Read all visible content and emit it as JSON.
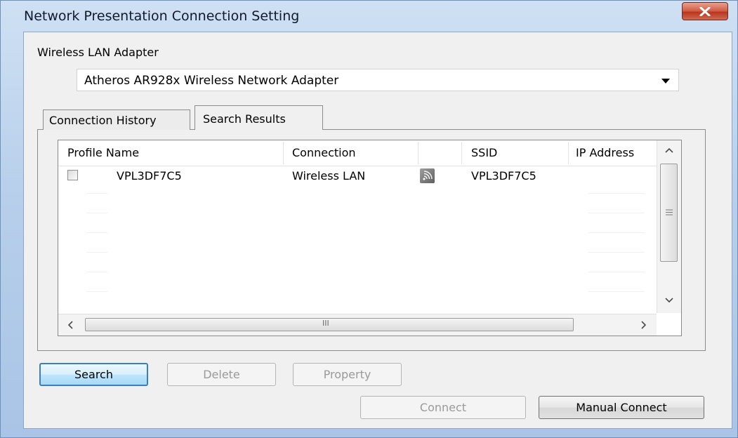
{
  "window": {
    "title": "Network Presentation Connection Setting"
  },
  "adapter": {
    "label": "Wireless LAN Adapter",
    "selected": "Atheros AR928x Wireless Network Adapter"
  },
  "tabs": [
    {
      "label": "Connection History",
      "active": false
    },
    {
      "label": "Search Results",
      "active": true
    }
  ],
  "table": {
    "columns": [
      "Profile Name",
      "Connection",
      "",
      "SSID",
      "IP Address"
    ],
    "rows": [
      {
        "profile": "VPL3DF7C5",
        "connection": "Wireless LAN",
        "icon": "wireless-signal-icon",
        "ssid": "VPL3DF7C5",
        "ip": ""
      }
    ],
    "hscroll_grip": "III"
  },
  "buttons": {
    "search": "Search",
    "delete": "Delete",
    "property": "Property",
    "connect": "Connect",
    "manual_connect": "Manual Connect"
  },
  "colors": {
    "title_bar": "#b7cfeb",
    "close_button": "#d25a42",
    "default_button_border": "#3c7fb1"
  }
}
